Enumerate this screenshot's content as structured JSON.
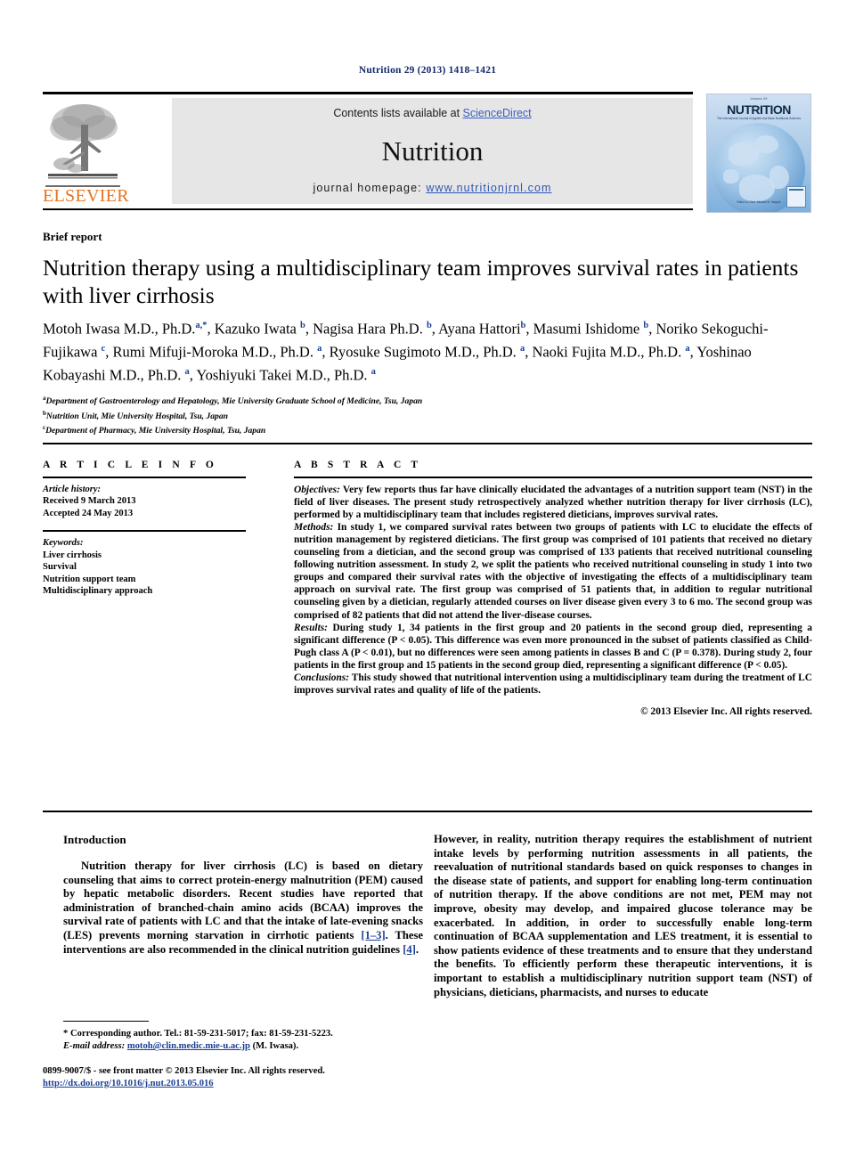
{
  "running_head": "Nutrition 29 (2013) 1418–1421",
  "masthead": {
    "publisher_logo_text": "ELSEVIER",
    "contents_prefix": "Contents lists available at ",
    "contents_link": "ScienceDirect",
    "journal_name": "Nutrition",
    "homepage_prefix": "journal homepage: ",
    "homepage_url": "www.nutritionjrnl.com",
    "cover": {
      "volume_line": "Volume 29",
      "title": "NUTRITION",
      "subtitle": "The International Journal of Applied and Basic Nutritional Sciences",
      "footer": "Editor-in-Chief: Michael M. Meguid"
    }
  },
  "article": {
    "type_label": "Brief report",
    "title": "Nutrition therapy using a multidisciplinary team improves survival rates in patients with liver cirrhosis",
    "authors_html": "Motoh Iwasa M.D., Ph.D.<sup>a,*</sup>, Kazuko Iwata <sup>b</sup>, Nagisa Hara Ph.D. <sup>b</sup>, Ayana Hattori<sup>b</sup>, Masumi Ishidome <sup>b</sup>, Noriko Sekoguchi-Fujikawa <sup>c</sup>, Rumi Mifuji-Moroka M.D., Ph.D. <sup>a</sup>, Ryosuke Sugimoto M.D., Ph.D. <sup>a</sup>, Naoki Fujita M.D., Ph.D. <sup>a</sup>, Yoshinao Kobayashi M.D., Ph.D. <sup>a</sup>, Yoshiyuki Takei M.D., Ph.D. <sup>a</sup>",
    "affiliations": [
      {
        "marker": "a",
        "text": "Department of Gastroenterology and Hepatology, Mie University Graduate School of Medicine, Tsu, Japan"
      },
      {
        "marker": "b",
        "text": "Nutrition Unit, Mie University Hospital, Tsu, Japan"
      },
      {
        "marker": "c",
        "text": "Department of Pharmacy, Mie University Hospital, Tsu, Japan"
      }
    ]
  },
  "article_info": {
    "heading": "A R T I C L E  I N F O",
    "history_label": "Article history:",
    "history": [
      "Received 9 March 2013",
      "Accepted 24 May 2013"
    ],
    "keywords_label": "Keywords:",
    "keywords": [
      "Liver cirrhosis",
      "Survival",
      "Nutrition support team",
      "Multidisciplinary approach"
    ]
  },
  "abstract": {
    "heading": "A B S T R A C T",
    "sections": [
      {
        "label": "Objectives:",
        "text": " Very few reports thus far have clinically elucidated the advantages of a nutrition support team (NST) in the field of liver diseases. The present study retrospectively analyzed whether nutrition therapy for liver cirrhosis (LC), performed by a multidisciplinary team that includes registered dieticians, improves survival rates."
      },
      {
        "label": "Methods:",
        "text": " In study 1, we compared survival rates between two groups of patients with LC to elucidate the effects of nutrition management by registered dieticians. The first group was comprised of 101 patients that received no dietary counseling from a dietician, and the second group was comprised of 133 patients that received nutritional counseling following nutrition assessment. In study 2, we split the patients who received nutritional counseling in study 1 into two groups and compared their survival rates with the objective of investigating the effects of a multidisciplinary team approach on survival rate. The first group was comprised of 51 patients that, in addition to regular nutritional counseling given by a dietician, regularly attended courses on liver disease given every 3 to 6 mo. The second group was comprised of 82 patients that did not attend the liver-disease courses."
      },
      {
        "label": "Results:",
        "text": " During study 1, 34 patients in the first group and 20 patients in the second group died, representing a significant difference (P < 0.05). This difference was even more pronounced in the subset of patients classified as Child-Pugh class A (P < 0.01), but no differences were seen among patients in classes B and C (P = 0.378). During study 2, four patients in the first group and 15 patients in the second group died, representing a significant difference (P < 0.05)."
      },
      {
        "label": "Conclusions:",
        "text": " This study showed that nutritional intervention using a multidisciplinary team during the treatment of LC improves survival rates and quality of life of the patients."
      }
    ],
    "copyright": "© 2013 Elsevier Inc. All rights reserved."
  },
  "body": {
    "left_heading": "Introduction",
    "left_paragraph_1": "Nutrition therapy for liver cirrhosis (LC) is based on dietary counseling that aims to correct protein-energy malnutrition (PEM) caused by hepatic metabolic disorders. Recent studies have reported that administration of branched-chain amino acids (BCAA) improves the survival rate of patients with LC and that the intake of late-evening snacks (LES) prevents morning starvation in cirrhotic patients ",
    "left_cite_1": "[1–3]",
    "left_paragraph_1b": ". These interventions are also recommended in the clinical nutrition guidelines ",
    "left_cite_2": "[4]",
    "left_paragraph_1c": ".",
    "right_paragraph_1": "However, in reality, nutrition therapy requires the establishment of nutrient intake levels by performing nutrition assessments in all patients, the reevaluation of nutritional standards based on quick responses to changes in the disease state of patients, and support for enabling long-term continuation of nutrition therapy. If the above conditions are not met, PEM may not improve, obesity may develop, and impaired glucose tolerance may be exacerbated. In addition, in order to successfully enable long-term continuation of BCAA supplementation and LES treatment, it is essential to show patients evidence of these treatments and to ensure that they understand the benefits. To efficiently perform these therapeutic interventions, it is important to establish a multidisciplinary nutrition support team (NST) of physicians, dieticians, pharmacists, and nurses to educate"
  },
  "footnotes": {
    "corresponding": "* Corresponding author. Tel.: 81-59-231-5017; fax: 81-59-231-5223.",
    "email_label": "E-mail address:",
    "email": "motoh@clin.medic.mie-u.ac.jp",
    "email_suffix": " (M. Iwasa).",
    "imprint_line": "0899-9007/$ - see front matter © 2013 Elsevier Inc. All rights reserved.",
    "doi": "http://dx.doi.org/10.1016/j.nut.2013.05.016"
  },
  "colors": {
    "link_blue": "#2d56b5",
    "cite_blue": "#1b3f94",
    "elsevier_orange": "#e8721c",
    "panel_gray": "#e6e6e6"
  }
}
